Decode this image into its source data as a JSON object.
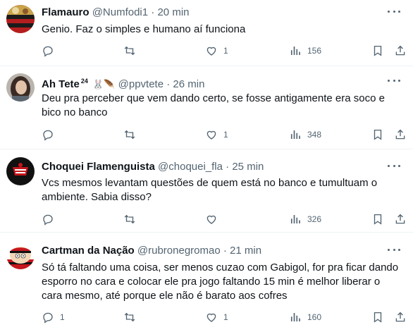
{
  "tweets": [
    {
      "name": "Flamauro",
      "handle": "@Numfodi1",
      "separator": "·",
      "time": "20 min",
      "text": "Genio. Faz o simples e humano aí funciona",
      "replies": "",
      "likes": "1",
      "views": "156",
      "avatar_icon": "flamengo-crest-avatar"
    },
    {
      "name": "Ah Tete",
      "sup": "24",
      "emoji": "🐰🪶",
      "handle": "@ppvtete",
      "separator": "·",
      "time": "26 min",
      "text": "Deu pra perceber que vem dando certo, se fosse antigamente era soco e bico no banco",
      "replies": "",
      "likes": "1",
      "views": "348",
      "avatar_icon": "person-photo-avatar"
    },
    {
      "name": "Choquei Flamenguista",
      "handle": "@choquei_fla",
      "separator": "·",
      "time": "25 min",
      "text": "Vcs mesmos levantam questões de quem está no banco e tumultuam o ambiente. Sabia disso?",
      "replies": "",
      "likes": "",
      "views": "326",
      "avatar_icon": "flamengo-logo-avatar"
    },
    {
      "name": "Cartman da Nação",
      "handle": "@rubronegromao",
      "separator": "·",
      "time": "21 min",
      "text": "Só tá faltando uma coisa, ser menos cuzao com Gabigol, for pra ficar dando esporro no cara e colocar ele pra jogo faltando 15 min é melhor liberar o cara mesmo, até porque ele não é barato aos cofres",
      "replies": "1",
      "likes": "1",
      "views": "160",
      "avatar_icon": "cartman-avatar"
    }
  ],
  "colors": {
    "text": "#0f1419",
    "secondary": "#536471",
    "divider": "#eff3f4"
  }
}
